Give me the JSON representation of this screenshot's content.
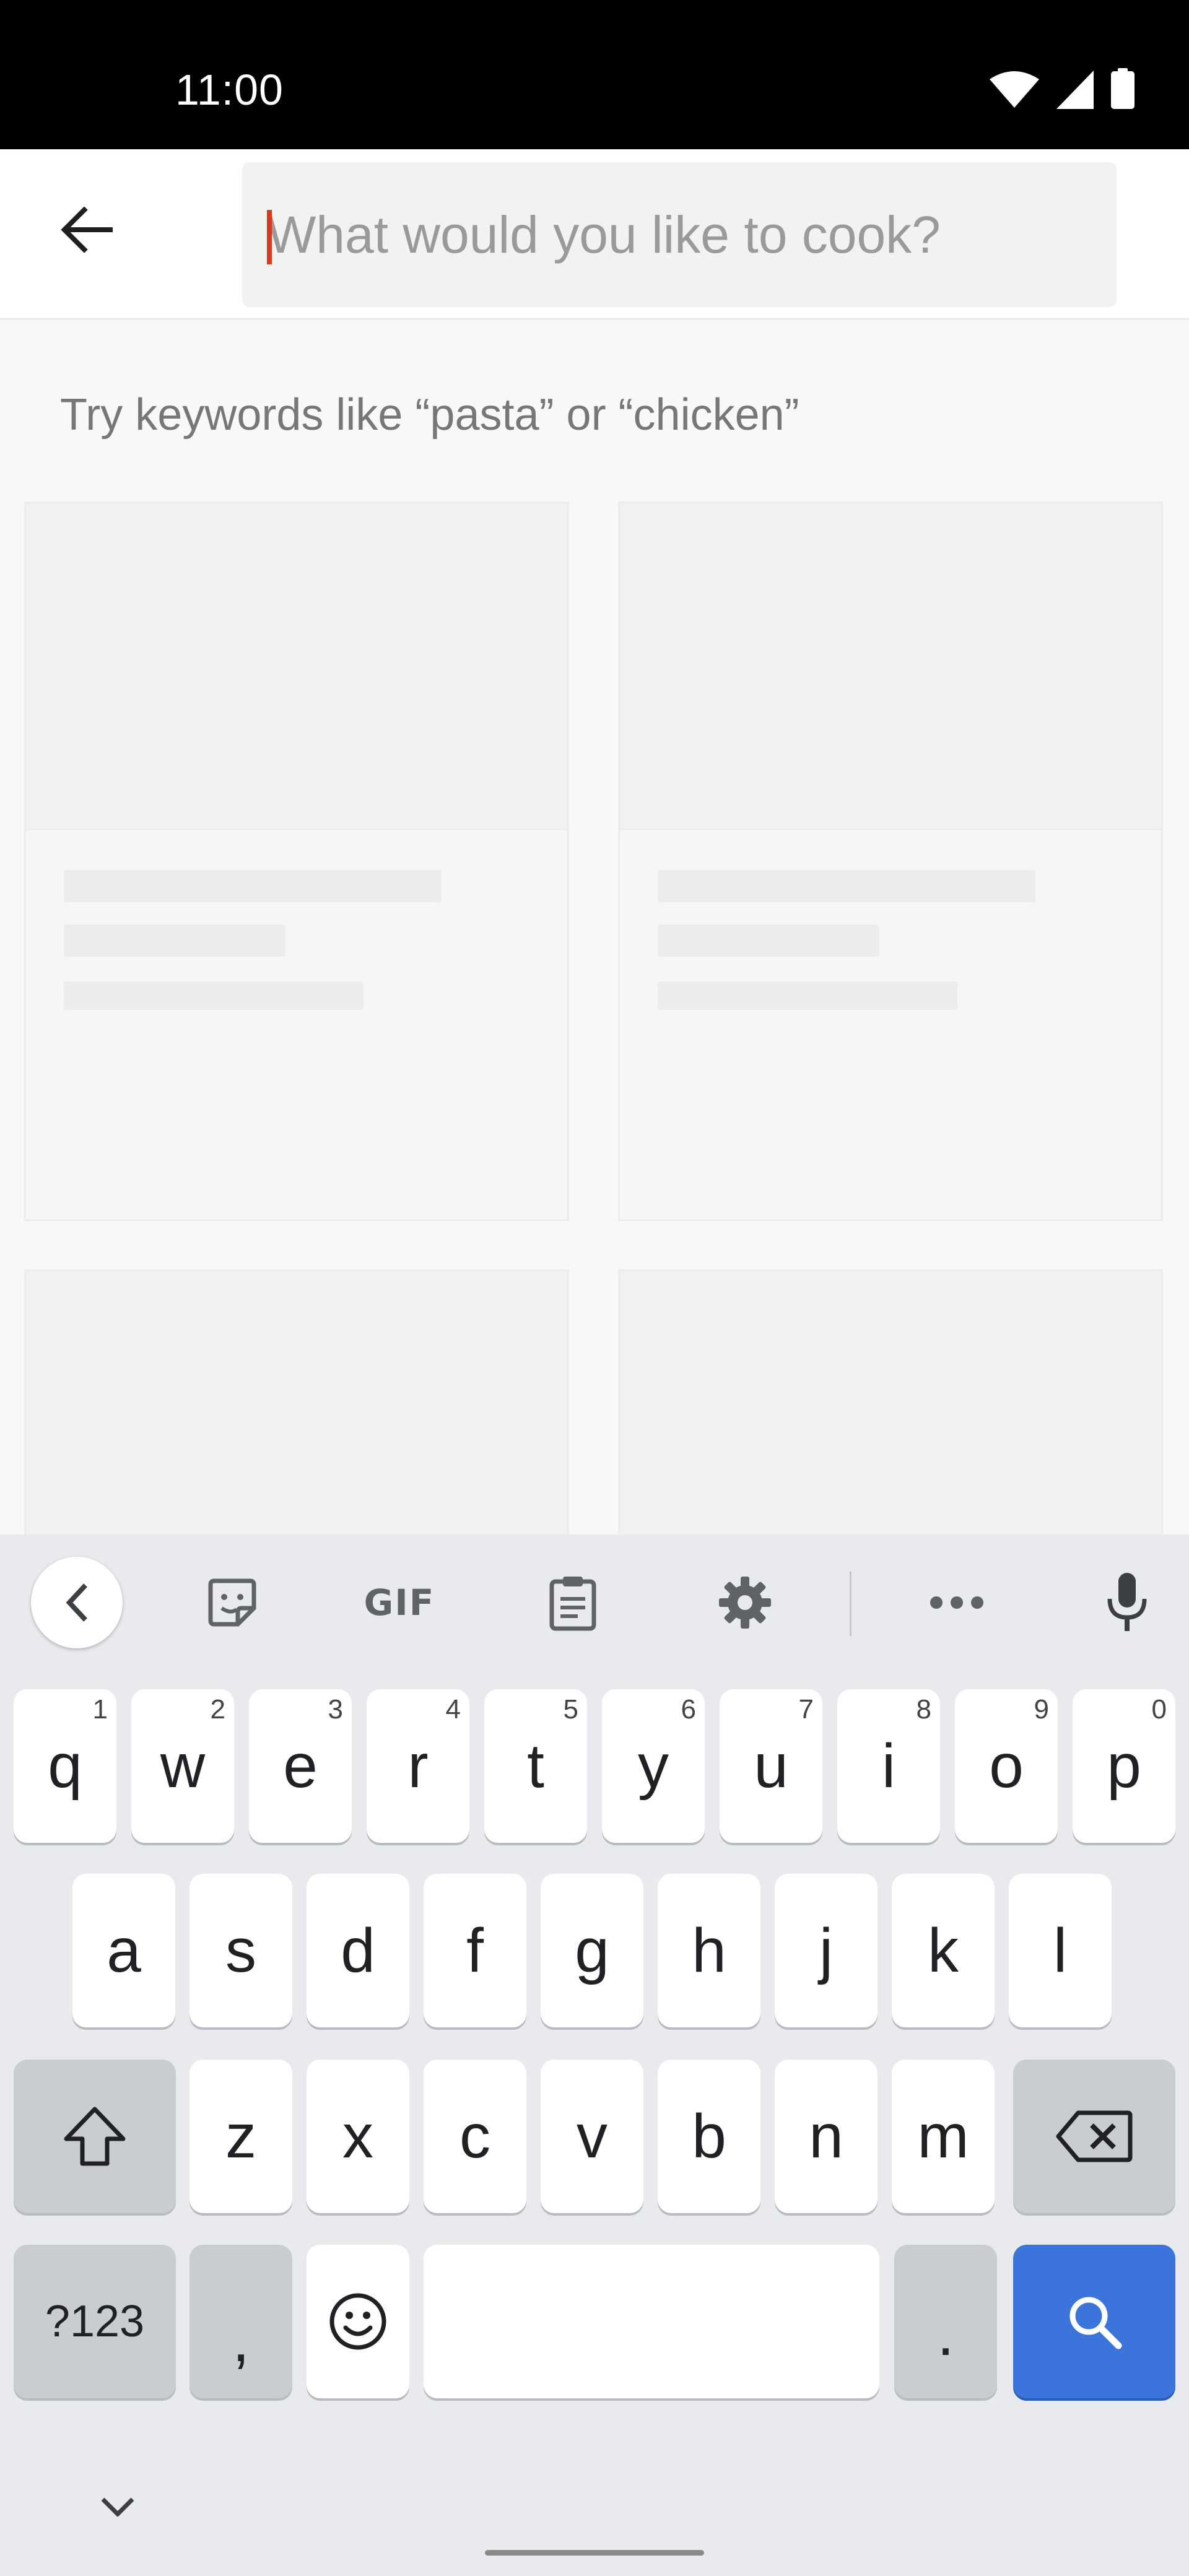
{
  "status_bar": {
    "time": "11:00",
    "icons": [
      "wifi-icon",
      "signal-icon",
      "battery-icon"
    ]
  },
  "app_bar": {
    "back_icon": "arrow-left-icon",
    "search": {
      "value": "",
      "placeholder": "What would you like to cook?"
    }
  },
  "content": {
    "hint": "Try keywords like “pasta” or “chicken”",
    "cards_state": "loading-skeleton"
  },
  "keyboard": {
    "toolbar": {
      "items": [
        "chevron-left-icon",
        "sticker-icon",
        "gif-label",
        "clipboard-icon",
        "gear-icon",
        "more-dots-icon",
        "mic-icon"
      ],
      "gif_label": "GIF"
    },
    "row1": [
      {
        "k": "q",
        "n": "1"
      },
      {
        "k": "w",
        "n": "2"
      },
      {
        "k": "e",
        "n": "3"
      },
      {
        "k": "r",
        "n": "4"
      },
      {
        "k": "t",
        "n": "5"
      },
      {
        "k": "y",
        "n": "6"
      },
      {
        "k": "u",
        "n": "7"
      },
      {
        "k": "i",
        "n": "8"
      },
      {
        "k": "o",
        "n": "9"
      },
      {
        "k": "p",
        "n": "0"
      }
    ],
    "row2": [
      "a",
      "s",
      "d",
      "f",
      "g",
      "h",
      "j",
      "k",
      "l"
    ],
    "row3": [
      "z",
      "x",
      "c",
      "v",
      "b",
      "n",
      "m"
    ],
    "symbols_label": "?123",
    "comma": ",",
    "period": ".",
    "colors": {
      "key": "#ffffff",
      "function_key": "#c9ccd1",
      "action_key": "#3b74db",
      "background": "#e8eaed",
      "caret": "#d63a20"
    }
  }
}
